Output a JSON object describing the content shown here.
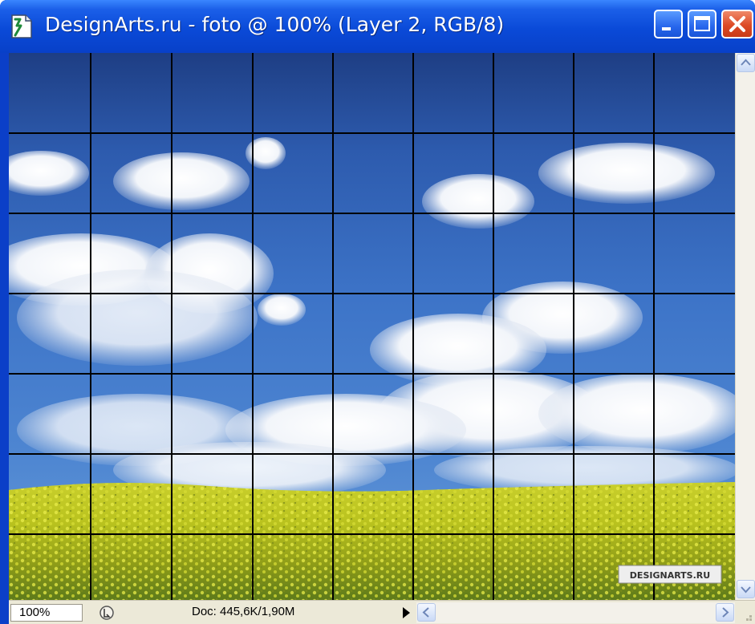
{
  "window": {
    "title": "DesignArts.ru - foto @ 100% (Layer 2, RGB/8)",
    "controls": [
      "minimize",
      "maximize",
      "close"
    ]
  },
  "canvas": {
    "watermark": "DESIGNARTS.RU",
    "grid_columns": 9,
    "grid_rows": 7,
    "grid_color": "#000000"
  },
  "statusbar": {
    "zoom": "100%",
    "doc_info": "Doc: 445,6K/1,90M"
  },
  "icons": {
    "app": "photoshop-document-icon",
    "minimize": "minimize-icon",
    "maximize": "maximize-icon",
    "close": "close-icon",
    "status": "status-info-icon",
    "menu": "triangle-right-icon"
  },
  "colors": {
    "titlebar": "#0a4ad8",
    "close_button": "#dd4a26",
    "chrome": "#ece9d8"
  }
}
